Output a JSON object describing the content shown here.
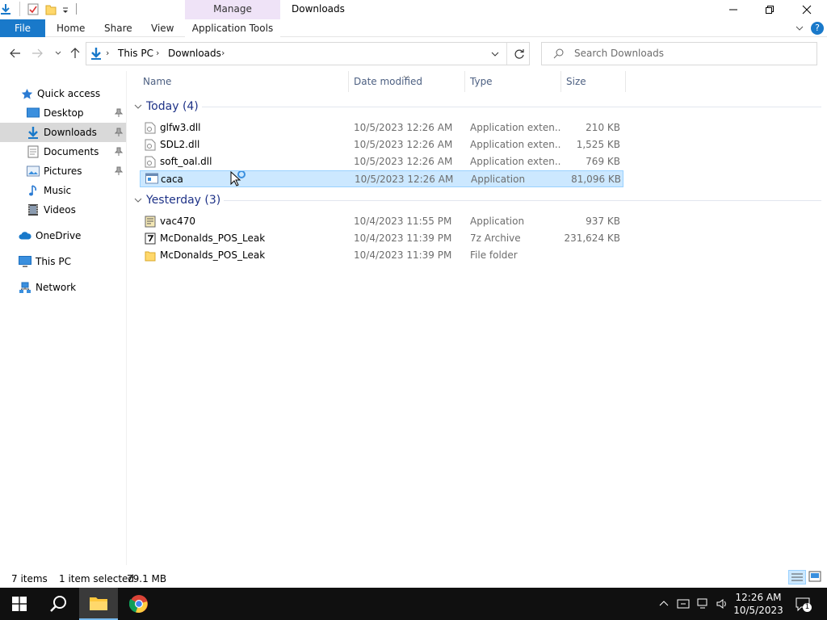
{
  "window": {
    "title": "Downloads",
    "context_tab": "Manage"
  },
  "ribbon": {
    "file": "File",
    "home": "Home",
    "share": "Share",
    "view": "View",
    "app_tools": "Application Tools"
  },
  "address": {
    "crumbs": [
      "This PC",
      "Downloads"
    ],
    "search_placeholder": "Search Downloads"
  },
  "nav": {
    "quick_access": "Quick access",
    "items": [
      {
        "label": "Desktop",
        "pinned": true
      },
      {
        "label": "Downloads",
        "pinned": true,
        "selected": true
      },
      {
        "label": "Documents",
        "pinned": true
      },
      {
        "label": "Pictures",
        "pinned": true
      },
      {
        "label": "Music",
        "pinned": false
      },
      {
        "label": "Videos",
        "pinned": false
      }
    ],
    "onedrive": "OneDrive",
    "this_pc": "This PC",
    "network": "Network"
  },
  "columns": {
    "name": "Name",
    "date": "Date modified",
    "type": "Type",
    "size": "Size"
  },
  "groups": [
    {
      "label": "Today (4)",
      "files": [
        {
          "name": "glfw3.dll",
          "date": "10/5/2023 12:26 AM",
          "type": "Application exten...",
          "size": "210 KB",
          "icon": "dll-icon"
        },
        {
          "name": "SDL2.dll",
          "date": "10/5/2023 12:26 AM",
          "type": "Application exten...",
          "size": "1,525 KB",
          "icon": "dll-icon"
        },
        {
          "name": "soft_oal.dll",
          "date": "10/5/2023 12:26 AM",
          "type": "Application exten...",
          "size": "769 KB",
          "icon": "dll-icon"
        },
        {
          "name": "caca",
          "date": "10/5/2023 12:26 AM",
          "type": "Application",
          "size": "81,096 KB",
          "icon": "exe-icon",
          "selected": true
        }
      ]
    },
    {
      "label": "Yesterday (3)",
      "files": [
        {
          "name": "vac470",
          "date": "10/4/2023 11:55 PM",
          "type": "Application",
          "size": "937 KB",
          "icon": "exe-icon"
        },
        {
          "name": "McDonalds_POS_Leak",
          "date": "10/4/2023 11:39 PM",
          "type": "7z Archive",
          "size": "231,624 KB",
          "icon": "archive-icon"
        },
        {
          "name": "McDonalds_POS_Leak",
          "date": "10/4/2023 11:39 PM",
          "type": "File folder",
          "size": "",
          "icon": "folder-icon"
        }
      ]
    }
  ],
  "status": {
    "count": "7 items",
    "selection": "1 item selected",
    "size": "79.1 MB"
  },
  "taskbar": {
    "time": "12:26 AM",
    "date": "10/5/2023",
    "notifications": "1"
  },
  "colors": {
    "accent": "#1979ca",
    "selection": "#cce8ff",
    "group_text": "#1e3287",
    "taskbar": "#101010"
  }
}
